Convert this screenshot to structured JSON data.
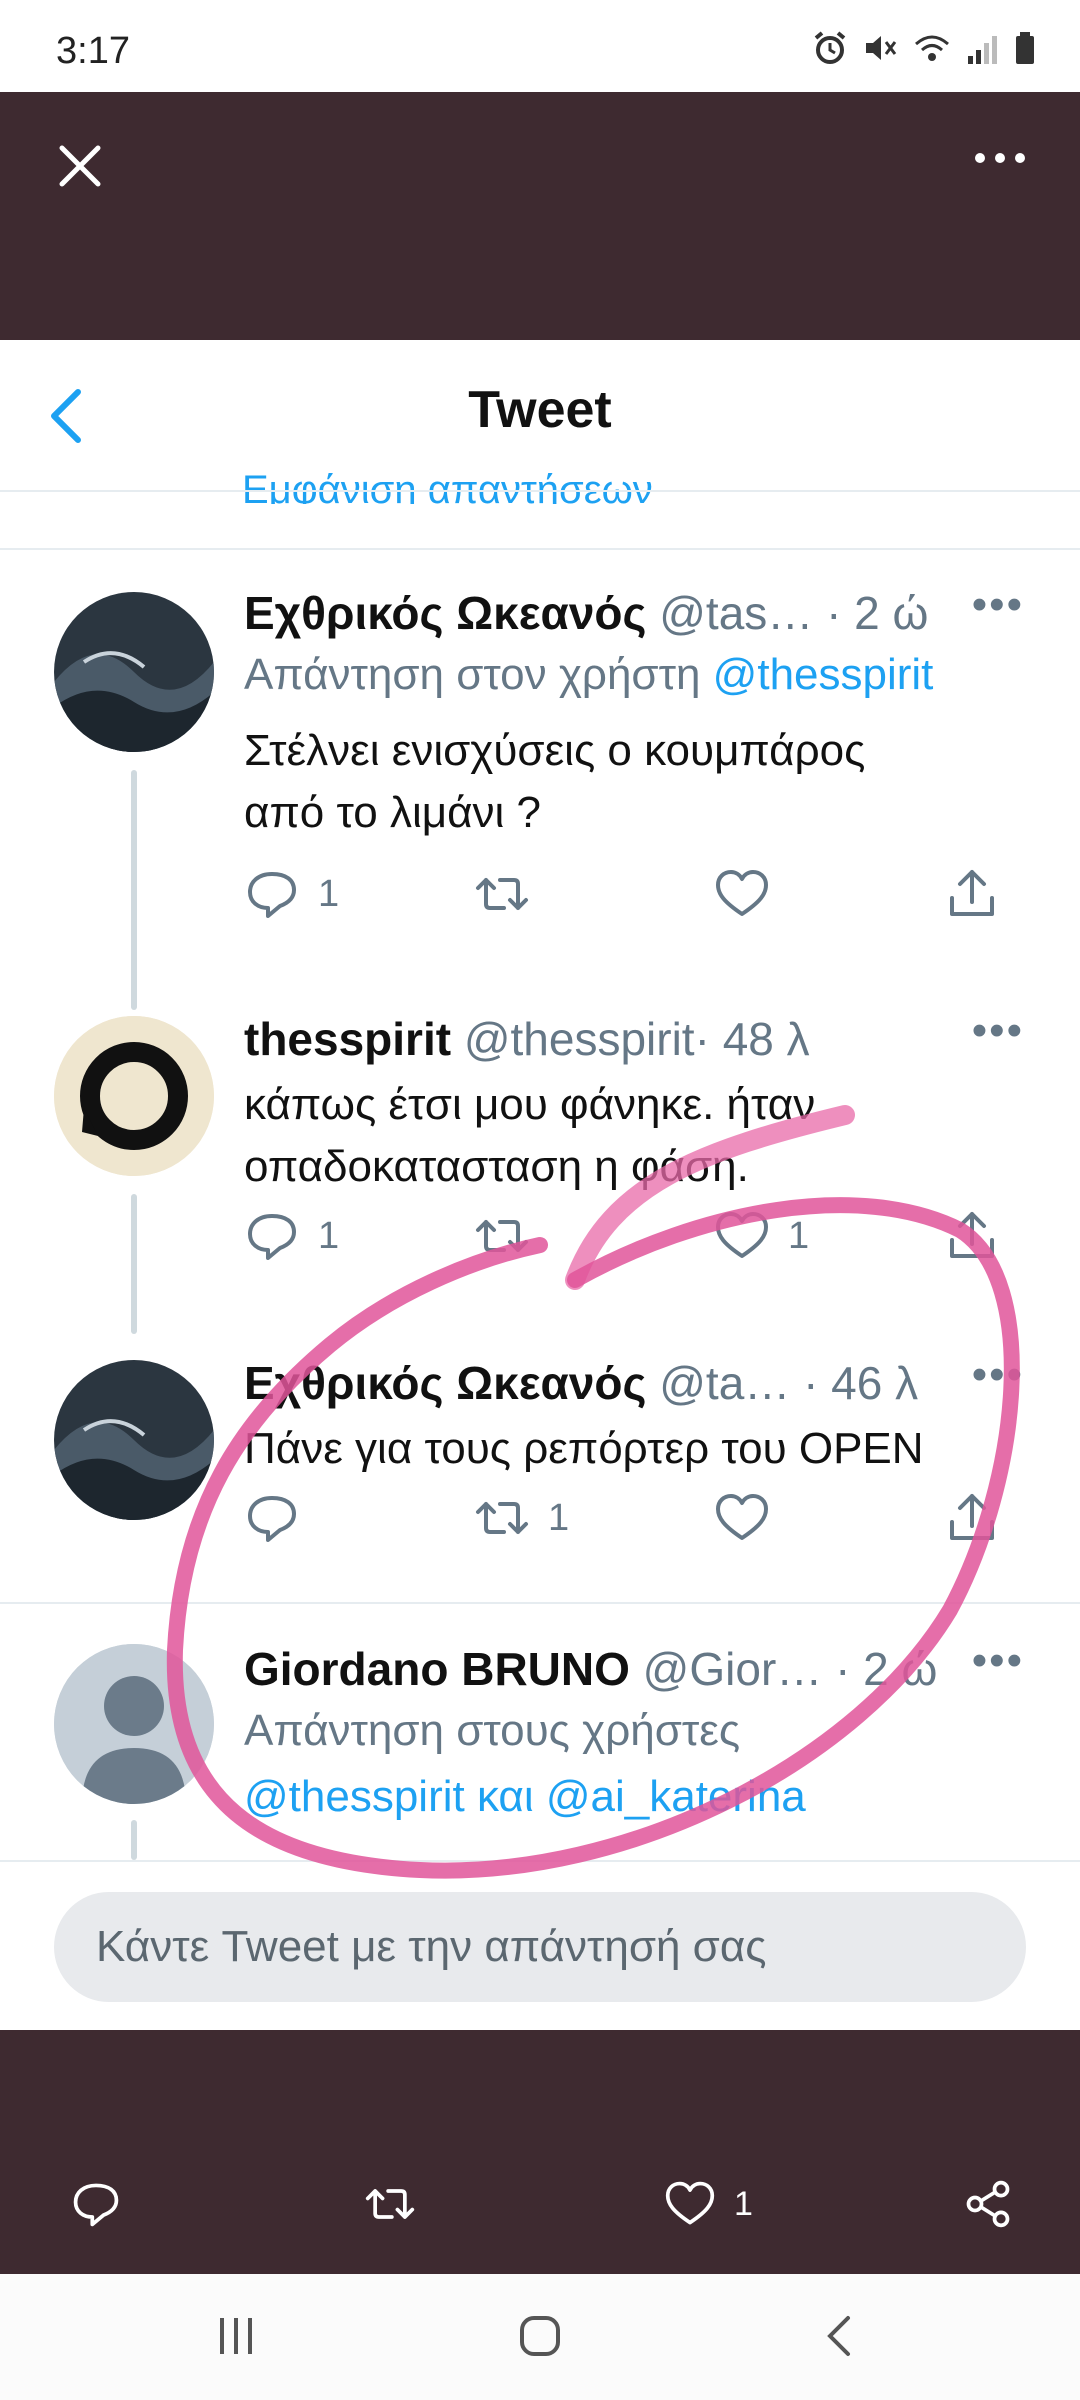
{
  "status_bar": {
    "time": "3:17"
  },
  "header": {
    "title": "Tweet"
  },
  "thread_cut_text": "Εμφάνιση απαντήσεων",
  "tweets": [
    {
      "name": "Εχθρικός Ωκεανός",
      "handle": "@tas…",
      "time": "· 2 ώ",
      "reply_prefix": "Απάντηση στον χρήστη ",
      "reply_users": "@thesspirit",
      "text_lines": [
        "Στέλνει ενισχύσεις ο κουμπάρος",
        "από το λιμάνι ?"
      ],
      "counts": {
        "replies": "1",
        "retweets": "",
        "likes": ""
      }
    },
    {
      "name": "thesspirit",
      "handle": "@thesspirit",
      "time": "· 48 λ",
      "text_lines": [
        "κάπως έτσι μου φάνηκε. ήταν",
        "οπαδοκατασταση η φάση."
      ],
      "counts": {
        "replies": "1",
        "retweets": "",
        "likes": "1"
      }
    },
    {
      "name": "Εχθρικός Ωκεανός",
      "handle": "@ta…",
      "time": "· 46 λ",
      "text_lines": [
        "Πάνε για τους ρεπόρτερ του OPEN"
      ],
      "counts": {
        "replies": "",
        "retweets": "1",
        "likes": ""
      }
    },
    {
      "name": "Giordano BRUNO",
      "handle": "@Gior…",
      "time": "· 2 ώ",
      "reply_prefix": "Απάντηση στους χρήστες",
      "reply_users": "@thesspirit και @ai_katerina"
    }
  ],
  "reply_box": {
    "placeholder": "Κάντε Tweet με την απάντησή σας"
  },
  "bottom_actions": {
    "likes": "1"
  },
  "colors": {
    "accent": "#1da1f2",
    "band": "#3e2a30",
    "annotation": "#e0559a"
  },
  "icons": [
    "close-icon",
    "more-icon",
    "back-icon",
    "reply-icon",
    "retweet-icon",
    "like-icon",
    "share-icon"
  ]
}
